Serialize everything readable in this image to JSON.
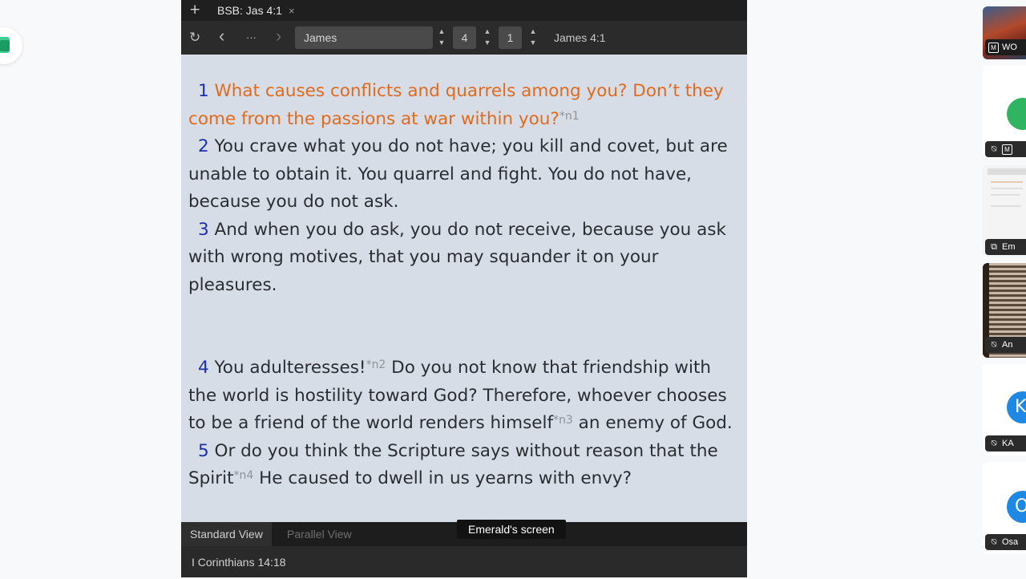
{
  "left_app_icon": "notes-app-icon",
  "tab": {
    "new_tab_symbol": "+",
    "title": "BSB: Jas 4:1",
    "close_symbol": "×"
  },
  "toolbar": {
    "refresh_icon": "↻",
    "back_icon": "‹",
    "more_icon": "···",
    "forward_icon": "›",
    "book": "James",
    "chapter": "4",
    "verse": "1",
    "reference": "James 4:1"
  },
  "passage": {
    "v1": {
      "num": "1",
      "text": "What causes conflicts and quarrels among you? Don’t they come from the passions at war within you?",
      "note": "*n1"
    },
    "v2": {
      "num": "2",
      "text": "You crave what you do not have; you kill and covet, but are unable to obtain it. You quarrel and fight. You do not have, because you do not ask."
    },
    "v3": {
      "num": "3",
      "text": "And when you do ask, you do not receive, because you ask with wrong motives, that you may squander it on your pleasures."
    },
    "v4": {
      "num": "4",
      "text_a": "You adulteresses!",
      "note_a": "*n2",
      "text_b": " Do you not know that friendship with the world is hostility toward God? Therefore, whoever chooses to be a friend of the world renders himself",
      "note_b": "*n3",
      "text_c": " an enemy of God."
    },
    "v5": {
      "num": "5",
      "text_a": "Or do you think the Scripture says without reason that the Spirit",
      "note_a": "*n4",
      "text_b": " He caused to dwell in us yearns with envy?"
    }
  },
  "view_tabs": {
    "standard": "Standard View",
    "parallel": "Parallel View"
  },
  "status": {
    "reference": "I Corinthians 14:18"
  },
  "screen_share_label": "Emerald's screen",
  "participants": [
    {
      "name": "WO",
      "badge": "M"
    },
    {
      "name": "",
      "badge": "M",
      "avatar_color": "#2fb561"
    },
    {
      "name": "Em"
    },
    {
      "name": "An"
    },
    {
      "name": "KA",
      "initial": "K",
      "avatar_color": "#1e88e5"
    },
    {
      "name": "Osa",
      "initial": "O",
      "avatar_color": "#1e88e5"
    }
  ],
  "colors": {
    "highlight_verse": "#e06b1e",
    "verse_number": "#1b2fb0",
    "content_bg": "#d6dde6"
  }
}
